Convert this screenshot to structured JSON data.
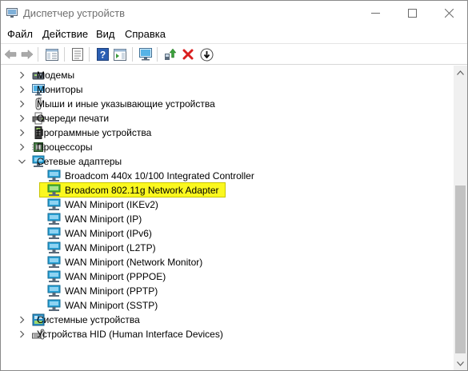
{
  "window": {
    "title": "Диспетчер устройств",
    "controls": [
      "minimize",
      "maximize",
      "close"
    ]
  },
  "menu": {
    "file": "Файл",
    "action": "Действие",
    "view": "Вид",
    "help": "Справка"
  },
  "toolbar": {
    "buttons": [
      "back-arrow-icon",
      "forward-arrow-icon",
      "properties-panel-icon",
      "list-view-icon",
      "help-icon",
      "action-pane-icon",
      "monitor-scan-icon",
      "update-driver-icon",
      "uninstall-device-icon",
      "download-driver-icon"
    ]
  },
  "tree": {
    "categories_top": [
      {
        "label": "Модемы",
        "icon": "modem-icon"
      },
      {
        "label": "Мониторы",
        "icon": "monitor-icon"
      },
      {
        "label": "Мыши и иные указывающие устройства",
        "icon": "mouse-icon"
      },
      {
        "label": "Очереди печати",
        "icon": "printer-icon"
      },
      {
        "label": "Программные устройства",
        "icon": "software-device-icon"
      },
      {
        "label": "Процессоры",
        "icon": "processor-icon"
      }
    ],
    "network_category": {
      "label": "Сетевые адаптеры",
      "icon": "network-adapter-icon",
      "expanded": true
    },
    "network_adapters": [
      {
        "label": "Broadcom 440x 10/100 Integrated Controller",
        "highlighted": false
      },
      {
        "label": "Broadcom 802.11g Network Adapter",
        "highlighted": true
      },
      {
        "label": "WAN Miniport (IKEv2)",
        "highlighted": false
      },
      {
        "label": "WAN Miniport (IP)",
        "highlighted": false
      },
      {
        "label": "WAN Miniport (IPv6)",
        "highlighted": false
      },
      {
        "label": "WAN Miniport (L2TP)",
        "highlighted": false
      },
      {
        "label": "WAN Miniport (Network Monitor)",
        "highlighted": false
      },
      {
        "label": "WAN Miniport (PPPOE)",
        "highlighted": false
      },
      {
        "label": "WAN Miniport (PPTP)",
        "highlighted": false
      },
      {
        "label": "WAN Miniport (SSTP)",
        "highlighted": false
      }
    ],
    "categories_bottom": [
      {
        "label": "Системные устройства",
        "icon": "system-device-icon"
      },
      {
        "label": "Устройства HID (Human Interface Devices)",
        "icon": "hid-device-icon"
      }
    ]
  },
  "colors": {
    "highlight": "#fbf81f",
    "network_icon": "#2aa3d8",
    "uninstall_red": "#d91f1f",
    "help_blue": "#2b5fb3"
  }
}
